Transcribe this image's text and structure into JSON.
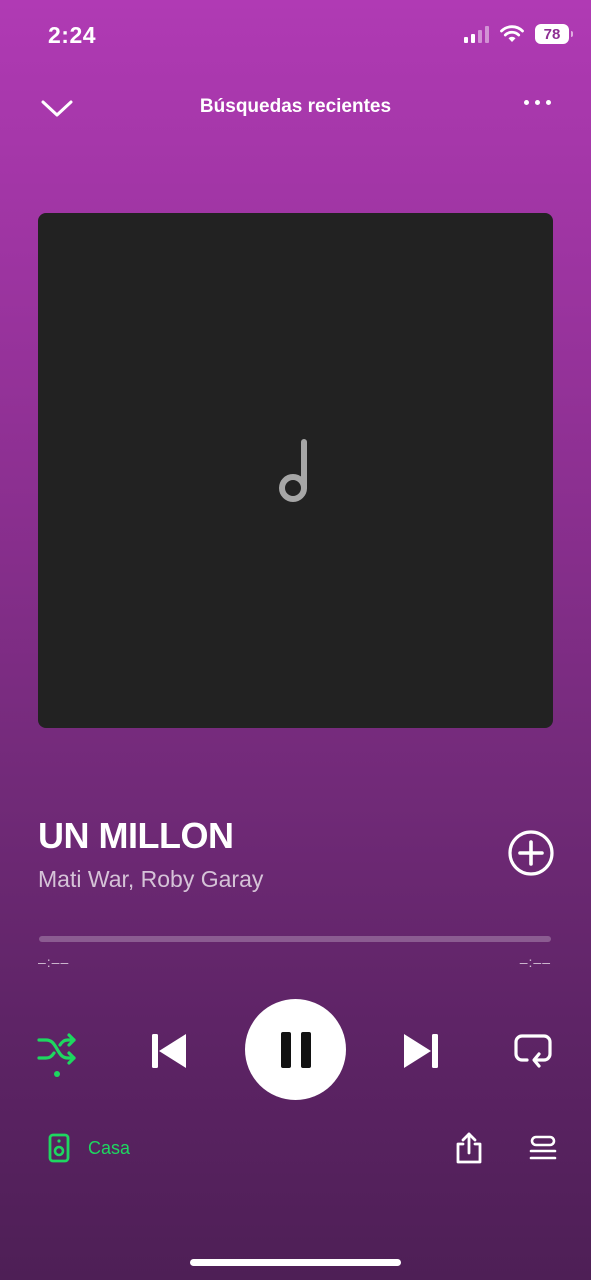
{
  "status_bar": {
    "time": "2:24",
    "battery": "78"
  },
  "header": {
    "title": "Búsquedas recientes"
  },
  "track": {
    "title": "UN MILLON",
    "artist": "Mati War, Roby Garay"
  },
  "progress": {
    "elapsed": "–:––",
    "remaining": "–:––",
    "fraction": 0
  },
  "controls": {
    "shuffle_active": true,
    "state": "playing"
  },
  "device": {
    "label": "Casa"
  },
  "colors": {
    "accent_green": "#1ed760",
    "gradient_top": "#b03ab4",
    "gradient_bottom": "#4e1f56",
    "artwork_bg": "#222222"
  },
  "icons": {
    "collapse": "chevron-down-icon",
    "more": "more-dots-icon",
    "placeholder": "music-note-icon",
    "add": "plus-circle-icon",
    "shuffle": "shuffle-icon",
    "previous": "skip-previous-icon",
    "pause": "pause-icon",
    "next": "skip-next-icon",
    "repeat": "repeat-icon",
    "device": "speaker-icon",
    "share": "share-icon",
    "queue": "queue-icon"
  }
}
